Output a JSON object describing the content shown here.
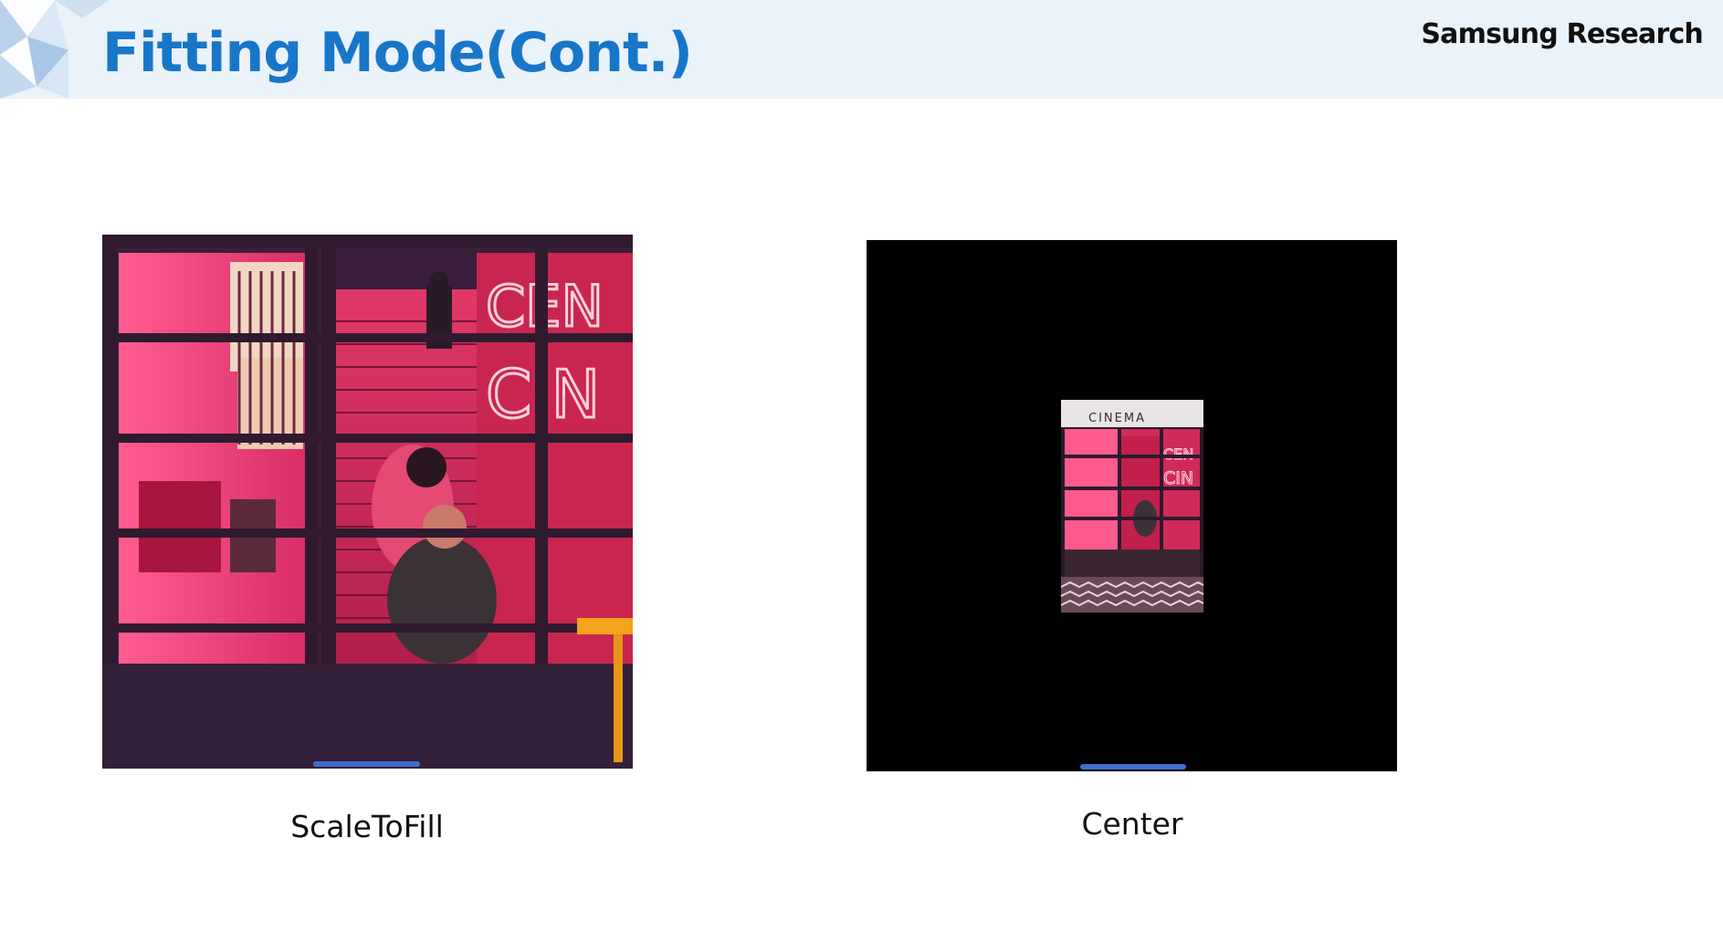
{
  "slide": {
    "title": "Fitting Mode(Cont.)",
    "brand": "Samsung Research"
  },
  "colors": {
    "title_blue": "#1876c9",
    "header_band": "#eaf2fa",
    "progress_blue": "#3d6fd0"
  },
  "panels": [
    {
      "caption": "ScaleToFill",
      "background": "#3a1f3c",
      "image": "cinema-neon-photo",
      "sign_line_1": "CEN",
      "sign_line_2": "CIN"
    },
    {
      "caption": "Center",
      "background": "#000000",
      "image": "cinema-neon-photo-small",
      "marquee_text": "CINEMA",
      "sign_line_1": "CEN",
      "sign_line_2": "CIN"
    }
  ]
}
